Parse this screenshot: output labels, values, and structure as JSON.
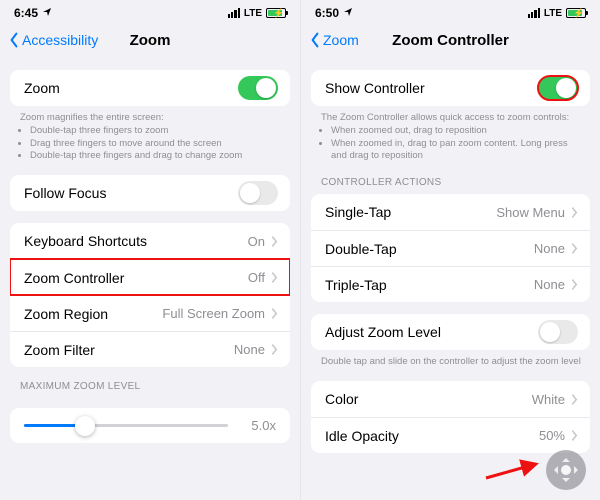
{
  "left": {
    "status": {
      "time": "6:45",
      "net": "LTE"
    },
    "back_label": "Accessibility",
    "title": "Zoom",
    "zoom_label": "Zoom",
    "zoom_on": true,
    "note_title": "Zoom magnifies the entire screen:",
    "note_items": [
      "Double-tap three fingers to zoom",
      "Drag three fingers to move around the screen",
      "Double-tap three fingers and drag to change zoom"
    ],
    "follow_focus_label": "Follow Focus",
    "follow_focus_on": false,
    "rows": {
      "keyboard": {
        "label": "Keyboard Shortcuts",
        "value": "On"
      },
      "controller": {
        "label": "Zoom Controller",
        "value": "Off"
      },
      "region": {
        "label": "Zoom Region",
        "value": "Full Screen Zoom"
      },
      "filter": {
        "label": "Zoom Filter",
        "value": "None"
      }
    },
    "max_header": "MAXIMUM ZOOM LEVEL",
    "slider_value": "5.0x"
  },
  "right": {
    "status": {
      "time": "6:50",
      "net": "LTE"
    },
    "back_label": "Zoom",
    "title": "Zoom Controller",
    "show_label": "Show Controller",
    "show_on": true,
    "note_title": "The Zoom Controller allows quick access to zoom controls:",
    "note_items": [
      "When zoomed out, drag to reposition",
      "When zoomed in, drag to pan zoom content. Long press and drag to reposition"
    ],
    "actions_header": "CONTROLLER ACTIONS",
    "actions": {
      "single": {
        "label": "Single-Tap",
        "value": "Show Menu"
      },
      "double": {
        "label": "Double-Tap",
        "value": "None"
      },
      "triple": {
        "label": "Triple-Tap",
        "value": "None"
      }
    },
    "adjust_label": "Adjust Zoom Level",
    "adjust_on": false,
    "adjust_note": "Double tap and slide on the controller to adjust the zoom level",
    "color": {
      "label": "Color",
      "value": "White"
    },
    "opacity": {
      "label": "Idle Opacity",
      "value": "50%"
    }
  }
}
